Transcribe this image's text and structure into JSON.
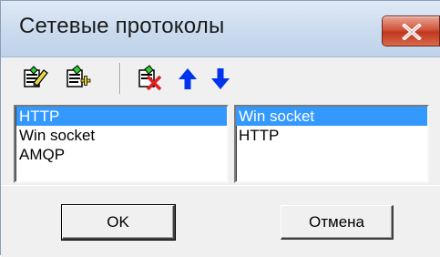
{
  "window": {
    "title": "Сетевые протоколы"
  },
  "toolbar": {
    "buttons": [
      {
        "icon": "edit-protocol-icon"
      },
      {
        "icon": "add-protocol-icon"
      },
      {
        "icon": "delete-protocol-icon"
      },
      {
        "icon": "move-up-arrow-icon"
      },
      {
        "icon": "move-down-arrow-icon"
      }
    ]
  },
  "left_list": {
    "items": [
      "HTTP",
      "Win socket",
      "AMQP"
    ],
    "selected": "HTTP"
  },
  "right_list": {
    "items": [
      "Win socket",
      "HTTP"
    ],
    "selected": "Win socket"
  },
  "buttons": {
    "ok_label": "OK",
    "cancel_label": "Отмена"
  },
  "colors": {
    "selection": "#3399ff",
    "arrow": "#0033ee",
    "close_button": "#c9452a"
  }
}
